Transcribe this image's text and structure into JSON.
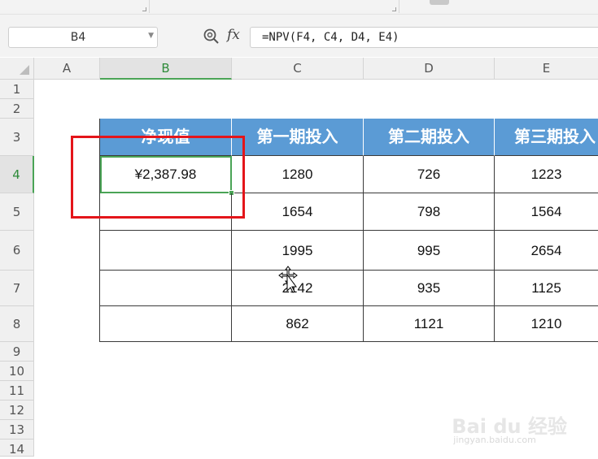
{
  "formula_bar": {
    "name_box": "B4",
    "fx_label": "fx",
    "formula": "=NPV(F4, C4, D4, E4)"
  },
  "columns": [
    "A",
    "B",
    "C",
    "D",
    "E"
  ],
  "selected_column": "B",
  "rows": [
    "1",
    "2",
    "3",
    "4",
    "5",
    "6",
    "7",
    "8",
    "9",
    "10",
    "11",
    "12",
    "13",
    "14"
  ],
  "selected_row": "4",
  "table": {
    "headers": [
      "净现值",
      "第一期投入",
      "第二期投入",
      "第三期投入"
    ],
    "body": [
      [
        "¥2,387.98",
        "1280",
        "726",
        "1223"
      ],
      [
        "",
        "1654",
        "798",
        "1564"
      ],
      [
        "",
        "1995",
        "995",
        "2654"
      ],
      [
        "",
        "2142",
        "935",
        "1125"
      ],
      [
        "",
        "862",
        "1121",
        "1210"
      ]
    ]
  },
  "colors": {
    "header_fill": "#5b9bd5",
    "selection_green": "#4aa456",
    "highlight_red": "#e4151a"
  },
  "watermark": {
    "brand": "Bai du 经验",
    "url": "jingyan.baidu.com"
  }
}
